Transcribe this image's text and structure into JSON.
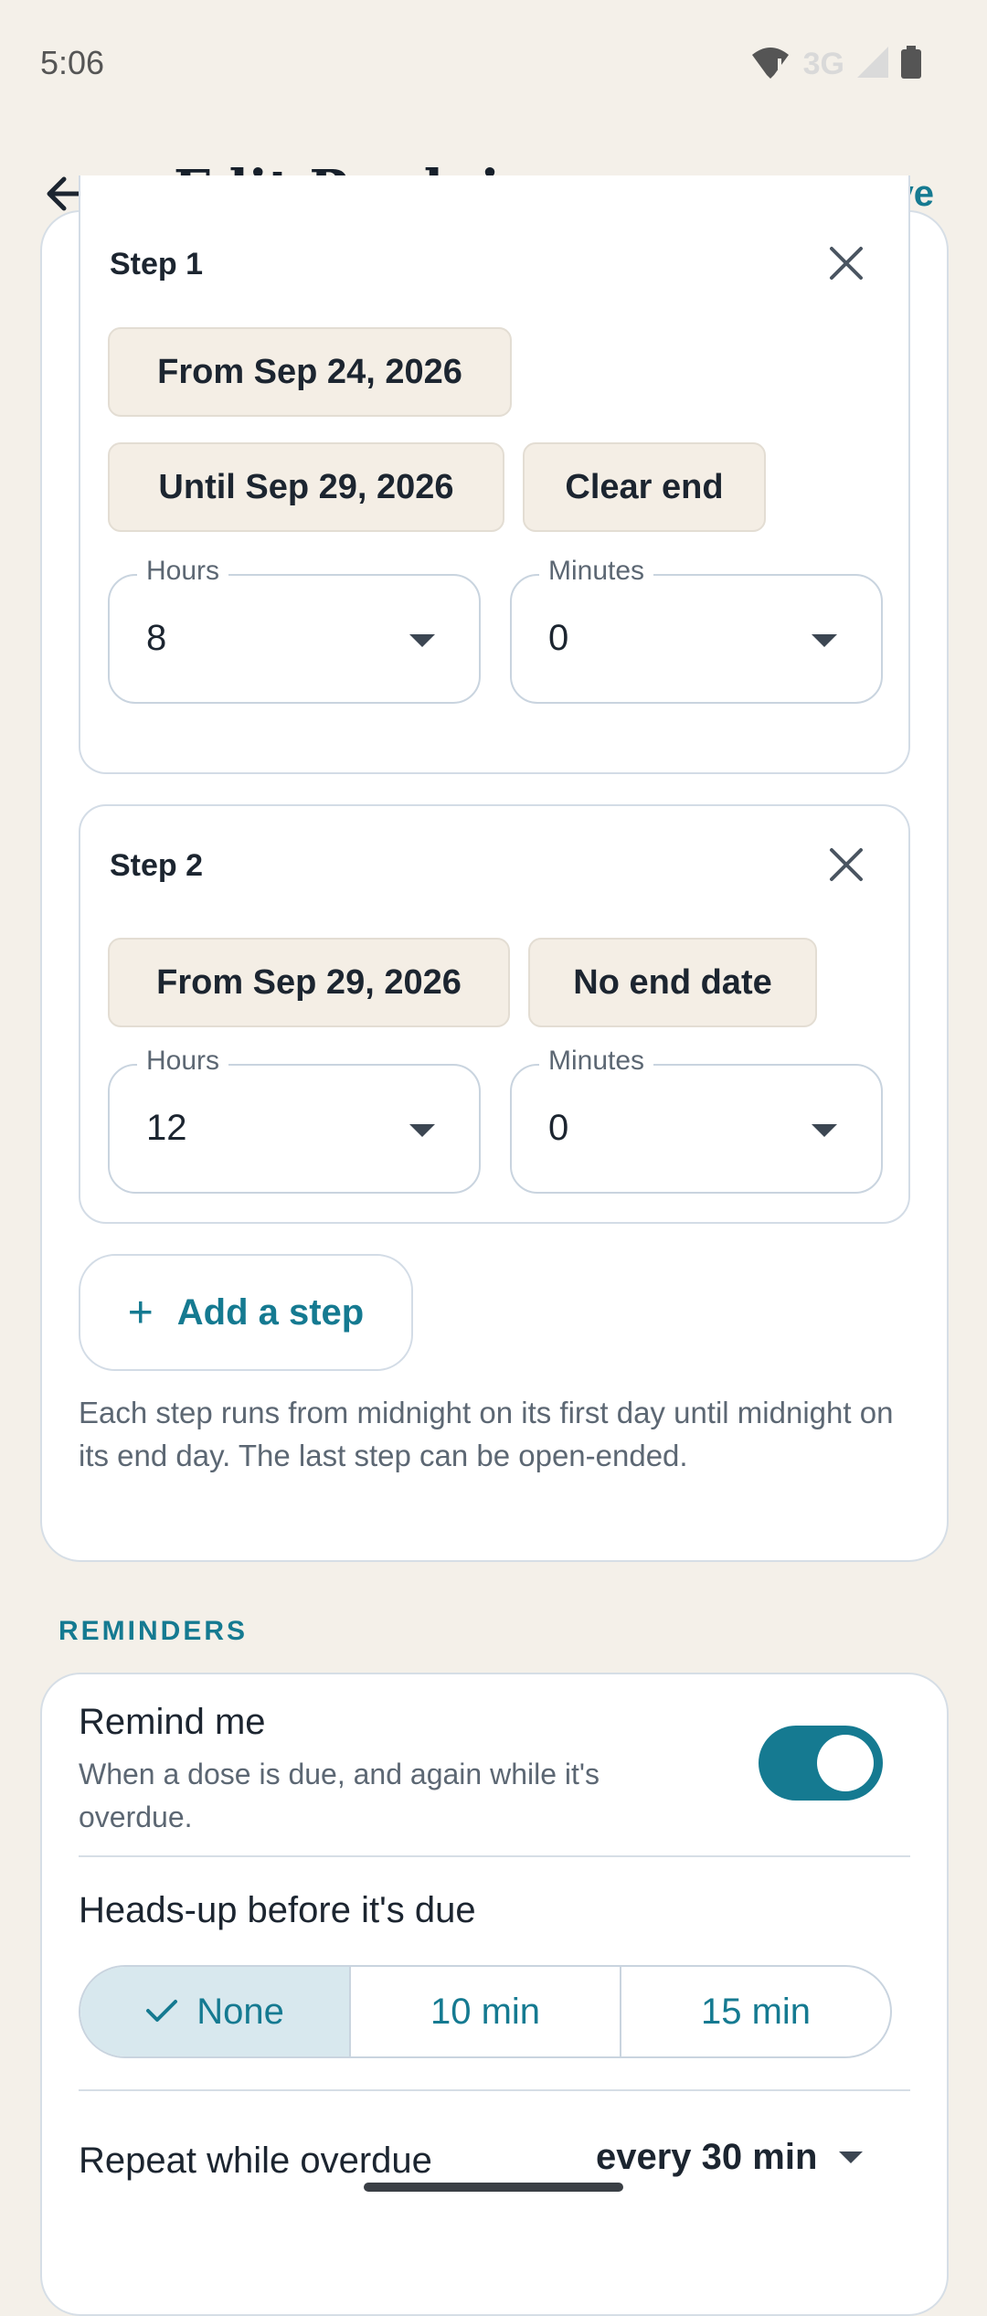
{
  "status_bar": {
    "time": "5:06",
    "network": "3G",
    "icons": [
      "wifi-alert-icon",
      "signal-icon",
      "battery-icon"
    ]
  },
  "app_bar": {
    "title": "Edit Prednisone",
    "save_label": "Save",
    "back_icon": "arrow-left-icon"
  },
  "steps": [
    {
      "title": "Step 1",
      "from": "From Sep 24, 2026",
      "until": "Until Sep 29, 2026",
      "clear_end": "Clear end",
      "hours_label": "Hours",
      "hours_value": "8",
      "minutes_label": "Minutes",
      "minutes_value": "0"
    },
    {
      "title": "Step 2",
      "from": "From Sep 29, 2026",
      "end": "No end date",
      "hours_label": "Hours",
      "hours_value": "12",
      "minutes_label": "Minutes",
      "minutes_value": "0"
    }
  ],
  "add_step": {
    "label": "Add a step",
    "icon": "+"
  },
  "help_text": "Each step runs from midnight on its first day until midnight on its end day. The last step can be open-ended.",
  "reminders": {
    "section_header": "REMINDERS",
    "remind_title": "Remind me",
    "remind_subtitle": "When a dose is due, and again while it's overdue.",
    "remind_enabled": true,
    "heads_up_title": "Heads-up before it's due",
    "heads_up_options": [
      "None",
      "10 min",
      "15 min"
    ],
    "heads_up_selected": "None",
    "repeat_title": "Repeat while overdue",
    "repeat_value": "every 30 min"
  },
  "colors": {
    "accent": "#157A91",
    "background": "#F4F0E9",
    "chip": "#F4EEE5",
    "selected_segment": "#D8E8EE"
  }
}
